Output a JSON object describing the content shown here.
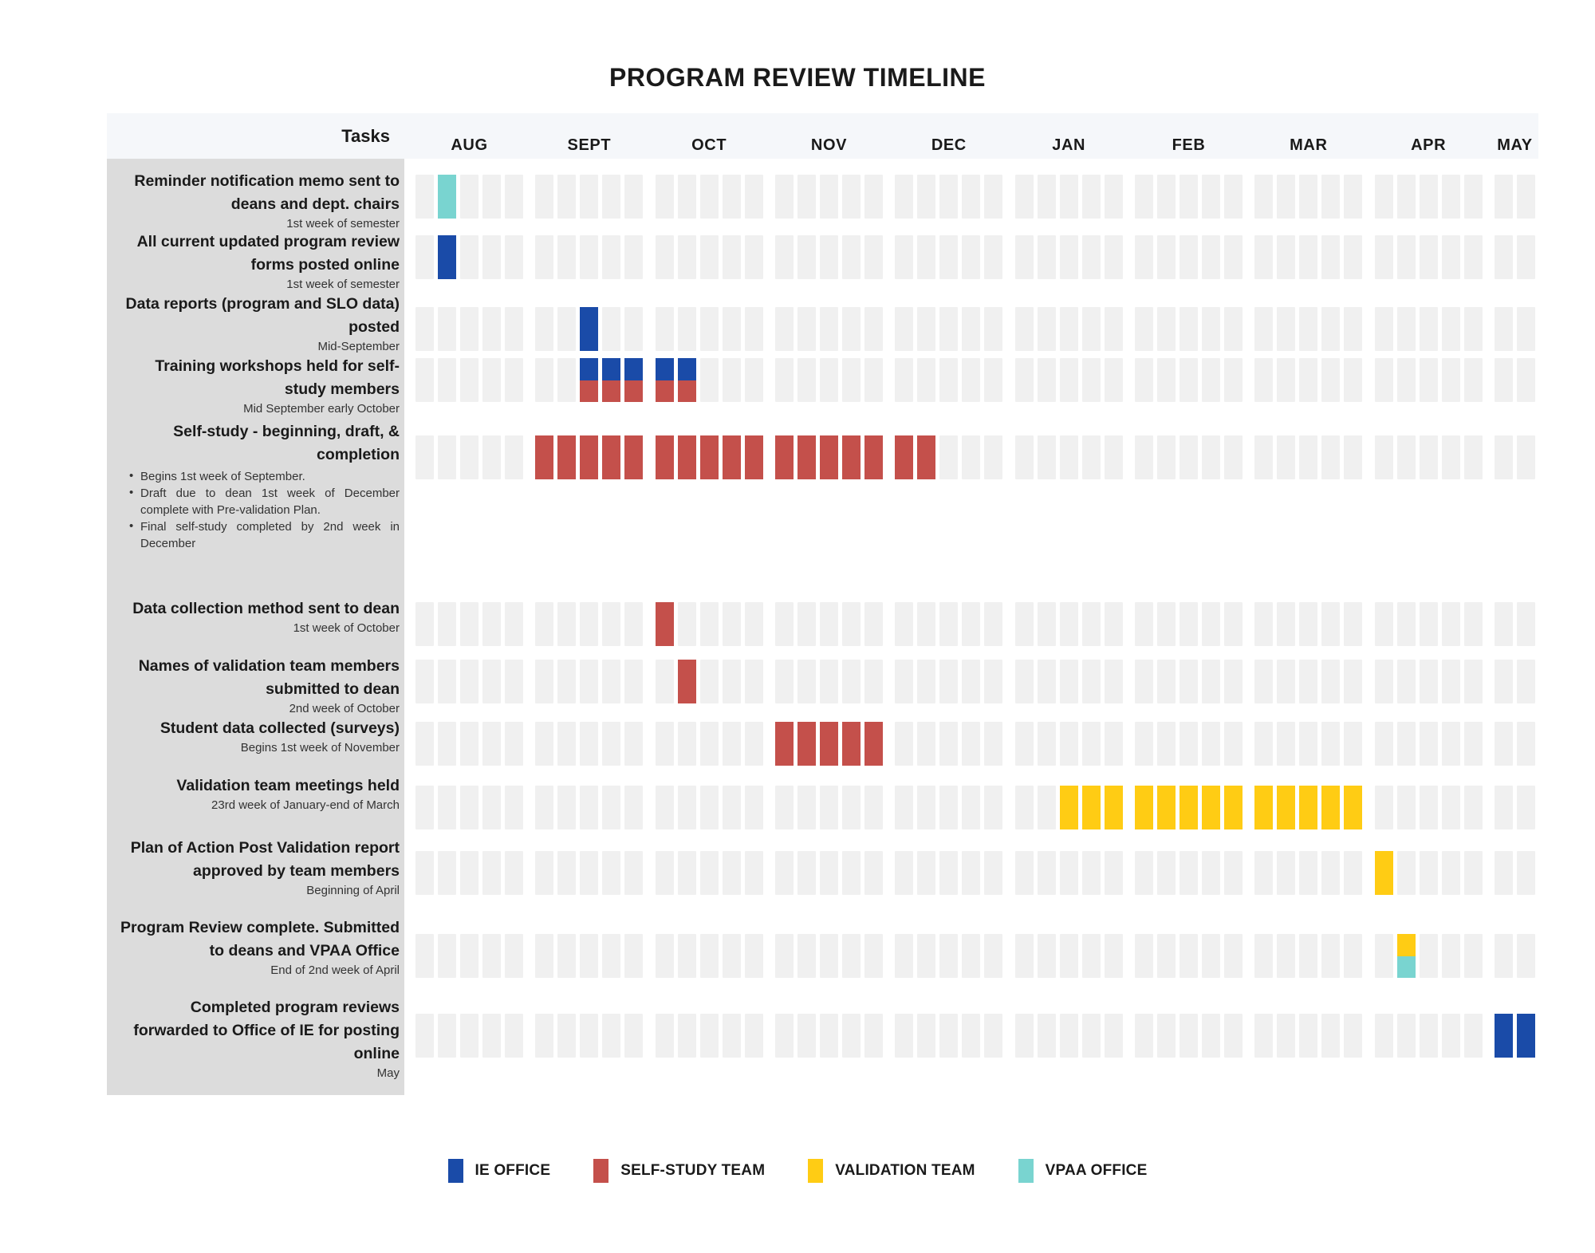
{
  "title": "PROGRAM REVIEW TIMELINE",
  "header": {
    "tasks_label": "Tasks"
  },
  "colors": {
    "ie_office": "#1A4BA8",
    "self_study_team": "#C4504B",
    "validation_team": "#FFCC14",
    "vpaa_office": "#79D4D0",
    "empty_cell": "#F0F0F0",
    "header_band": "#F5F7FA",
    "task_column": "#DCDCDC"
  },
  "legend": [
    {
      "label": "IE OFFICE",
      "color": "#1A4BA8",
      "key": "ie_office"
    },
    {
      "label": "SELF-STUDY TEAM",
      "color": "#C4504B",
      "key": "self_study_team"
    },
    {
      "label": "VALIDATION TEAM",
      "color": "#FFCC14",
      "key": "validation_team"
    },
    {
      "label": "VPAA OFFICE",
      "color": "#79D4D0",
      "key": "vpaa_office"
    }
  ],
  "chart_data": {
    "type": "bar",
    "subtype": "gantt",
    "title": "PROGRAM REVIEW TIMELINE",
    "xlabel": "",
    "ylabel": "Tasks",
    "grid": false,
    "legend_position": "bottom",
    "months": [
      {
        "label": "AUG",
        "weeks": 5
      },
      {
        "label": "SEPT",
        "weeks": 5
      },
      {
        "label": "OCT",
        "weeks": 5
      },
      {
        "label": "NOV",
        "weeks": 5
      },
      {
        "label": "DEC",
        "weeks": 5
      },
      {
        "label": "JAN",
        "weeks": 5
      },
      {
        "label": "FEB",
        "weeks": 5
      },
      {
        "label": "MAR",
        "weeks": 5
      },
      {
        "label": "APR",
        "weeks": 5
      },
      {
        "label": "MAY",
        "weeks": 2
      }
    ],
    "tasks": [
      {
        "title": "Reminder notification memo sent to deans and dept. chairs",
        "sub": "1st week of semester",
        "bullets": [],
        "bars": [
          {
            "month": "AUG",
            "week": 2,
            "teams": [
              "vpaa_office"
            ]
          }
        ]
      },
      {
        "title": "All current updated program review forms posted online",
        "sub": "1st week of semester",
        "bullets": [],
        "bars": [
          {
            "month": "AUG",
            "week": 2,
            "teams": [
              "ie_office"
            ]
          }
        ]
      },
      {
        "title": "Data reports (program and SLO data) posted",
        "sub": "Mid-September",
        "bullets": [],
        "bars": [
          {
            "month": "SEPT",
            "week": 3,
            "teams": [
              "ie_office"
            ]
          }
        ]
      },
      {
        "title": "Training workshops held for self-study members",
        "sub": "Mid September early October",
        "bullets": [],
        "bars": [
          {
            "month": "SEPT",
            "week": 3,
            "teams": [
              "ie_office",
              "self_study_team"
            ]
          },
          {
            "month": "SEPT",
            "week": 4,
            "teams": [
              "ie_office",
              "self_study_team"
            ]
          },
          {
            "month": "SEPT",
            "week": 5,
            "teams": [
              "ie_office",
              "self_study_team"
            ]
          },
          {
            "month": "OCT",
            "week": 1,
            "teams": [
              "ie_office",
              "self_study_team"
            ]
          },
          {
            "month": "OCT",
            "week": 2,
            "teams": [
              "ie_office",
              "self_study_team"
            ]
          }
        ]
      },
      {
        "title": "Self-study - beginning, draft, & completion",
        "sub": "",
        "bullets": [
          "Begins 1st week of September.",
          "Draft due to dean 1st week of December complete with Pre-validation Plan.",
          "Final self-study completed by 2nd week in December"
        ],
        "bars": [
          {
            "month": "SEPT",
            "week": 1,
            "teams": [
              "self_study_team"
            ]
          },
          {
            "month": "SEPT",
            "week": 2,
            "teams": [
              "self_study_team"
            ]
          },
          {
            "month": "SEPT",
            "week": 3,
            "teams": [
              "self_study_team"
            ]
          },
          {
            "month": "SEPT",
            "week": 4,
            "teams": [
              "self_study_team"
            ]
          },
          {
            "month": "SEPT",
            "week": 5,
            "teams": [
              "self_study_team"
            ]
          },
          {
            "month": "OCT",
            "week": 1,
            "teams": [
              "self_study_team"
            ]
          },
          {
            "month": "OCT",
            "week": 2,
            "teams": [
              "self_study_team"
            ]
          },
          {
            "month": "OCT",
            "week": 3,
            "teams": [
              "self_study_team"
            ]
          },
          {
            "month": "OCT",
            "week": 4,
            "teams": [
              "self_study_team"
            ]
          },
          {
            "month": "OCT",
            "week": 5,
            "teams": [
              "self_study_team"
            ]
          },
          {
            "month": "NOV",
            "week": 1,
            "teams": [
              "self_study_team"
            ]
          },
          {
            "month": "NOV",
            "week": 2,
            "teams": [
              "self_study_team"
            ]
          },
          {
            "month": "NOV",
            "week": 3,
            "teams": [
              "self_study_team"
            ]
          },
          {
            "month": "NOV",
            "week": 4,
            "teams": [
              "self_study_team"
            ]
          },
          {
            "month": "NOV",
            "week": 5,
            "teams": [
              "self_study_team"
            ]
          },
          {
            "month": "DEC",
            "week": 1,
            "teams": [
              "self_study_team"
            ]
          },
          {
            "month": "DEC",
            "week": 2,
            "teams": [
              "self_study_team"
            ]
          }
        ]
      },
      {
        "title": "Data collection method sent to dean",
        "sub": "1st week of October",
        "bullets": [],
        "bars": [
          {
            "month": "OCT",
            "week": 1,
            "teams": [
              "self_study_team"
            ]
          }
        ]
      },
      {
        "title": "Names of validation team members submitted to dean",
        "sub": "2nd week of October",
        "bullets": [],
        "bars": [
          {
            "month": "OCT",
            "week": 2,
            "teams": [
              "self_study_team"
            ]
          }
        ]
      },
      {
        "title": "Student data collected (surveys)",
        "sub": "Begins 1st week of November",
        "bullets": [],
        "bars": [
          {
            "month": "NOV",
            "week": 1,
            "teams": [
              "self_study_team"
            ]
          },
          {
            "month": "NOV",
            "week": 2,
            "teams": [
              "self_study_team"
            ]
          },
          {
            "month": "NOV",
            "week": 3,
            "teams": [
              "self_study_team"
            ]
          },
          {
            "month": "NOV",
            "week": 4,
            "teams": [
              "self_study_team"
            ]
          },
          {
            "month": "NOV",
            "week": 5,
            "teams": [
              "self_study_team"
            ]
          }
        ]
      },
      {
        "title": "Validation team meetings held",
        "sub": "23rd week of January-end of March",
        "bullets": [],
        "bars": [
          {
            "month": "JAN",
            "week": 3,
            "teams": [
              "validation_team"
            ]
          },
          {
            "month": "JAN",
            "week": 4,
            "teams": [
              "validation_team"
            ]
          },
          {
            "month": "JAN",
            "week": 5,
            "teams": [
              "validation_team"
            ]
          },
          {
            "month": "FEB",
            "week": 1,
            "teams": [
              "validation_team"
            ]
          },
          {
            "month": "FEB",
            "week": 2,
            "teams": [
              "validation_team"
            ]
          },
          {
            "month": "FEB",
            "week": 3,
            "teams": [
              "validation_team"
            ]
          },
          {
            "month": "FEB",
            "week": 4,
            "teams": [
              "validation_team"
            ]
          },
          {
            "month": "FEB",
            "week": 5,
            "teams": [
              "validation_team"
            ]
          },
          {
            "month": "MAR",
            "week": 1,
            "teams": [
              "validation_team"
            ]
          },
          {
            "month": "MAR",
            "week": 2,
            "teams": [
              "validation_team"
            ]
          },
          {
            "month": "MAR",
            "week": 3,
            "teams": [
              "validation_team"
            ]
          },
          {
            "month": "MAR",
            "week": 4,
            "teams": [
              "validation_team"
            ]
          },
          {
            "month": "MAR",
            "week": 5,
            "teams": [
              "validation_team"
            ]
          }
        ]
      },
      {
        "title": "Plan of Action Post Validation report approved by team members",
        "sub": "Beginning of April",
        "bullets": [],
        "bars": [
          {
            "month": "APR",
            "week": 1,
            "teams": [
              "validation_team"
            ]
          }
        ]
      },
      {
        "title": "Program Review complete. Submitted to deans and VPAA Office",
        "sub": "End of 2nd week of April",
        "bullets": [],
        "bars": [
          {
            "month": "APR",
            "week": 2,
            "teams": [
              "validation_team",
              "vpaa_office"
            ]
          }
        ]
      },
      {
        "title": "Completed program reviews forwarded to Office of IE for posting online",
        "sub": "May",
        "bullets": [],
        "bars": [
          {
            "month": "MAY",
            "week": 1,
            "teams": [
              "ie_office"
            ]
          },
          {
            "month": "MAY",
            "week": 2,
            "teams": [
              "ie_office"
            ]
          }
        ]
      }
    ]
  }
}
